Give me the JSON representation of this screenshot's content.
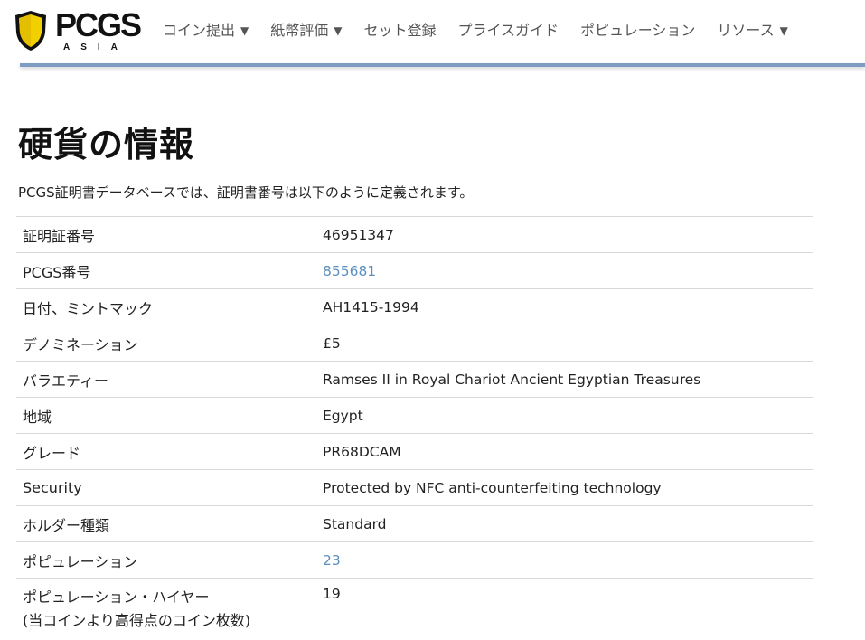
{
  "logo": {
    "text": "PCGS",
    "sub": "ASIA"
  },
  "nav": [
    {
      "label": "コイン提出",
      "caret": "▼"
    },
    {
      "label": "紙幣評価",
      "caret": "▼"
    },
    {
      "label": "セット登録",
      "caret": ""
    },
    {
      "label": "プライスガイド",
      "caret": ""
    },
    {
      "label": "ポピュレーション",
      "caret": ""
    },
    {
      "label": "リソース",
      "caret": "▼"
    }
  ],
  "page": {
    "title": "硬貨の情報",
    "intro": "PCGS証明書データベースでは、証明書番号は以下のように定義されます。"
  },
  "rows": [
    {
      "label": "証明証番号",
      "value": "46951347"
    },
    {
      "label": "PCGS番号",
      "value": "855681"
    },
    {
      "label": "日付、ミントマック",
      "value": "AH1415-1994"
    },
    {
      "label": "デノミネーション",
      "value": "£5"
    },
    {
      "label": "バラエティー",
      "value": "Ramses II in Royal Chariot Ancient Egyptian Treasures"
    },
    {
      "label": "地域",
      "value": "Egypt"
    },
    {
      "label": "グレード",
      "value": "PR68DCAM"
    },
    {
      "label": "Security",
      "value": "Protected by NFC anti-counterfeiting technology"
    },
    {
      "label": "ホルダー種類",
      "value": "Standard"
    },
    {
      "label": "ポピュレーション",
      "value": "23"
    },
    {
      "label": "ポピュレーション・ハイヤー",
      "label2": "(当コインより高得点のコイン枚数)",
      "value": "19"
    }
  ],
  "colors": {
    "accent_line": "#7e9cc3",
    "link": "#5b8fbf",
    "shield_fill": "#f2d000"
  },
  "icons": {
    "logo_shield": "shield-icon"
  }
}
